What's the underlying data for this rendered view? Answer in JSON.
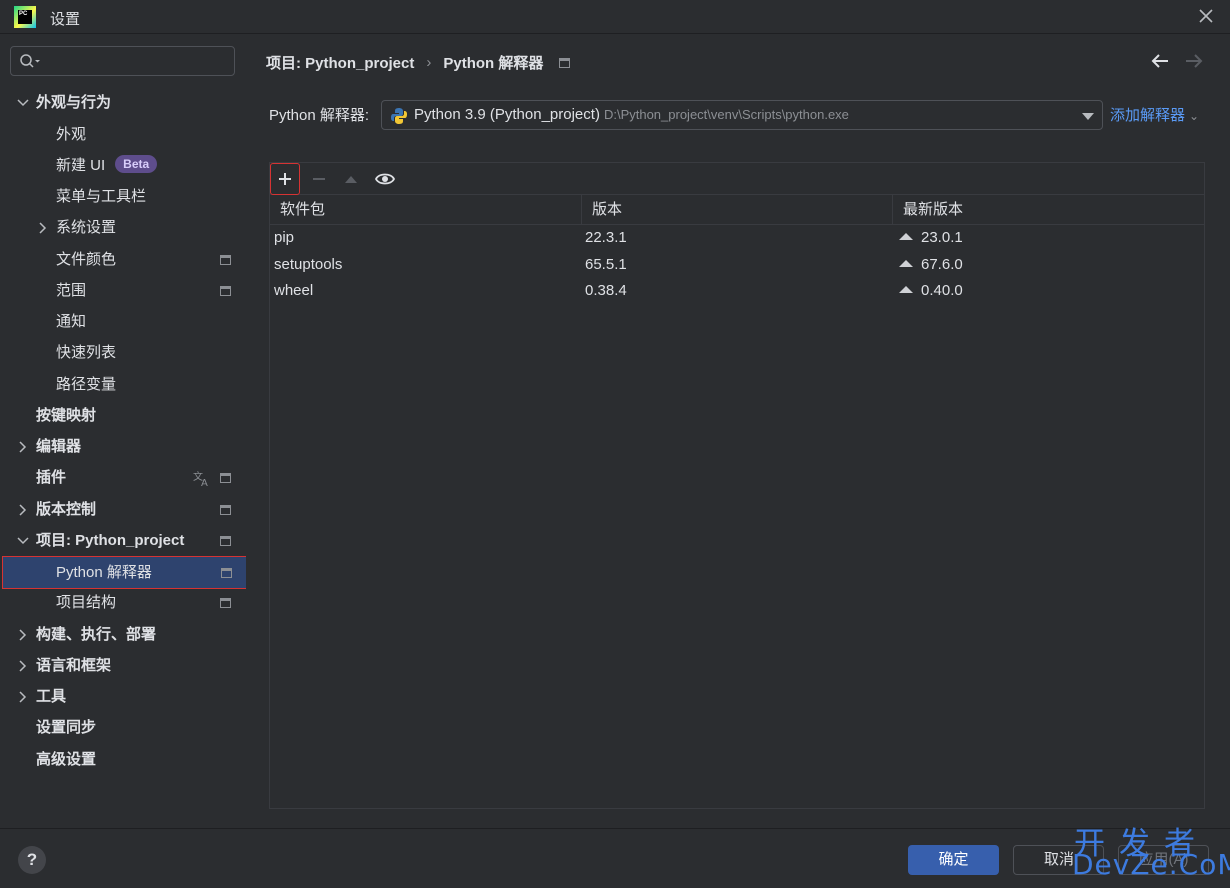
{
  "window": {
    "title": "设置",
    "app_logo_text": "PC"
  },
  "sidebar": {
    "items": [
      {
        "label": "外观与行为",
        "expanded": true
      },
      {
        "label": "外观"
      },
      {
        "label": "新建 UI",
        "badge": "Beta"
      },
      {
        "label": "菜单与工具栏"
      },
      {
        "label": "系统设置"
      },
      {
        "label": "文件颜色"
      },
      {
        "label": "范围"
      },
      {
        "label": "通知"
      },
      {
        "label": "快速列表"
      },
      {
        "label": "路径变量"
      },
      {
        "label": "按键映射"
      },
      {
        "label": "编辑器"
      },
      {
        "label": "插件"
      },
      {
        "label": "版本控制"
      },
      {
        "label": "项目: Python_project"
      },
      {
        "label": "Python 解释器",
        "selected": true
      },
      {
        "label": "项目结构"
      },
      {
        "label": "构建、执行、部署"
      },
      {
        "label": "语言和框架"
      },
      {
        "label": "工具"
      },
      {
        "label": "设置同步"
      },
      {
        "label": "高级设置"
      }
    ]
  },
  "breadcrumb": {
    "project": "项目: Python_project",
    "page": "Python 解释器"
  },
  "interpreter": {
    "label": "Python 解释器:",
    "name": "Python 3.9 (Python_project)",
    "path": "D:\\Python_project\\venv\\Scripts\\python.exe",
    "add_label": "添加解释器"
  },
  "packages": {
    "columns": [
      "软件包",
      "版本",
      "最新版本"
    ],
    "rows": [
      {
        "name": "pip",
        "version": "22.3.1",
        "latest": "23.0.1"
      },
      {
        "name": "setuptools",
        "version": "65.5.1",
        "latest": "67.6.0"
      },
      {
        "name": "wheel",
        "version": "0.38.4",
        "latest": "0.40.0"
      }
    ]
  },
  "footer": {
    "ok": "确定",
    "cancel": "取消",
    "apply": "应用(A)",
    "help": "?"
  },
  "watermark": {
    "top": "开发者",
    "bottom": "DevZe.CoM"
  },
  "colors": {
    "accent": "#5a9af5",
    "selection": "#2e436e",
    "highlight_border": "#d63333",
    "beta_bg": "#5e4d8c"
  }
}
